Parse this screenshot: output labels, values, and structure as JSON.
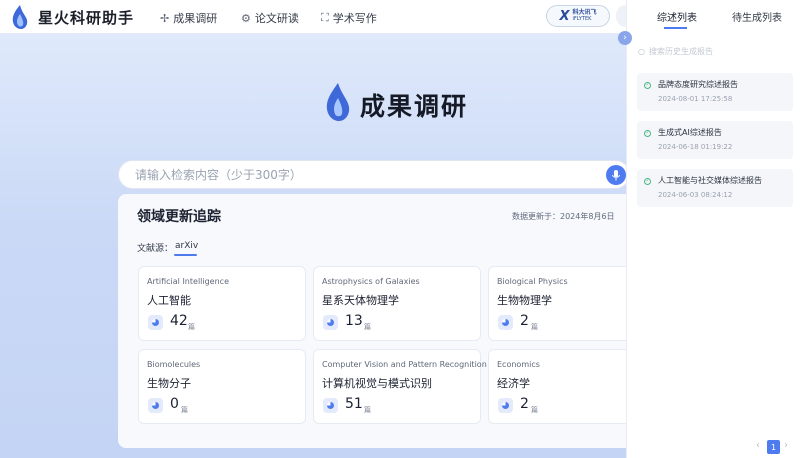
{
  "app": {
    "title": "星火科研助手"
  },
  "nav": [
    {
      "label": "成果调研",
      "icon": "sparkle-icon"
    },
    {
      "label": "论文研读",
      "icon": "brain-icon"
    },
    {
      "label": "学术写作",
      "icon": "expand-icon"
    }
  ],
  "brand_badge": {
    "mark": "X",
    "line1": "科大讯飞",
    "line2": "iFLYTEK"
  },
  "hero": {
    "title": "成果调研"
  },
  "search": {
    "placeholder": "请输入检索内容（少于300字）"
  },
  "tracking": {
    "title": "领域更新追踪",
    "update_date": "数据更新于：2024年8月6日",
    "source_label": "文献源：",
    "source_tab": "arXiv"
  },
  "fields": [
    {
      "en": "Artificial Intelligence",
      "cn": "人工智能",
      "count": "42",
      "unit": "篇"
    },
    {
      "en": "Astrophysics of Galaxies",
      "cn": "星系天体物理学",
      "count": "13",
      "unit": "篇"
    },
    {
      "en": "Biological Physics",
      "cn": "生物物理学",
      "count": "2",
      "unit": "篇"
    },
    {
      "en": "Biomolecules",
      "cn": "生物分子",
      "count": "0",
      "unit": "篇"
    },
    {
      "en": "Computer Vision and Pattern Recognition",
      "cn": "计算机视觉与模式识别",
      "count": "51",
      "unit": "篇"
    },
    {
      "en": "Economics",
      "cn": "经济学",
      "count": "2",
      "unit": "篇"
    }
  ],
  "sidebar": {
    "tabs": [
      "综述列表",
      "待生成列表"
    ],
    "search_placeholder": "搜索历史生成报告",
    "reports": [
      {
        "title": "品牌态度研究综述报告",
        "date": "2024-08-01 17:25:58"
      },
      {
        "title": "生成式AI综述报告",
        "date": "2024-06-18 01:19:22"
      },
      {
        "title": "人工智能与社交媒体综述报告",
        "date": "2024-06-03 08:24:12"
      }
    ],
    "pagination": {
      "prev": "‹",
      "page": "1",
      "next": "›"
    }
  },
  "colors": {
    "accent": "#4e7cf0",
    "success": "#4cb782",
    "text": "#1b2130"
  }
}
